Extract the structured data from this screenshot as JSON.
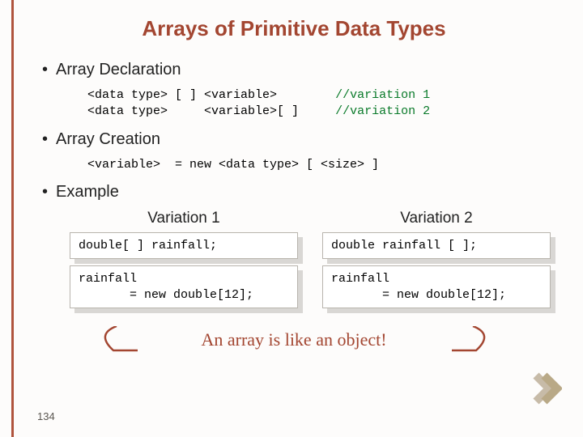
{
  "title": "Arrays of Primitive Data Types",
  "bullets": {
    "b1": "Array Declaration",
    "b2": "Array Creation",
    "b3": "Example"
  },
  "code": {
    "decl_l1a": "<data type> [ ] <variable>",
    "decl_l1b": "//variation 1",
    "decl_l2a": "<data type>     <variable>[ ]",
    "decl_l2b": "//variation 2",
    "creation": "<variable>  = new <data type> [ <size> ]"
  },
  "columns": {
    "left_title": "Variation 1",
    "right_title": "Variation 2",
    "left_box1": "double[ ] rainfall;",
    "left_box2": "rainfall\n       = new double[12];",
    "right_box1": "double rainfall [ ];",
    "right_box2": "rainfall\n       = new double[12];"
  },
  "callout": "An array is like an object!",
  "page": "134"
}
